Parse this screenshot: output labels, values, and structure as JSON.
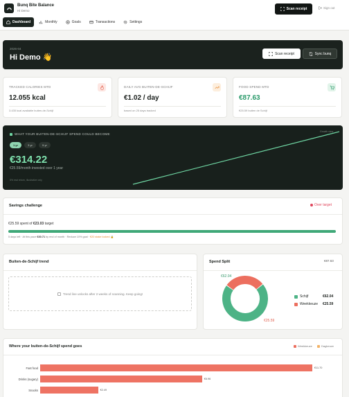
{
  "app": {
    "title": "Bunq Bite Balance",
    "subtitle": "Hi Demo"
  },
  "topbar": {
    "scan_label": "Scan receipt",
    "signout_label": "Sign out"
  },
  "nav": [
    "Dashboard",
    "Monthly",
    "Goals",
    "Transactions",
    "Settings"
  ],
  "hero": {
    "date": "2026-04",
    "greeting": "Hi Demo 👋",
    "scan_label": "Scan receipt",
    "sync_label": "Sync bunq"
  },
  "stats": [
    {
      "label": "Tracked calories MTD",
      "value": "12.055 kcal",
      "sub": "3.435 kcal available buiten-de-Schijf"
    },
    {
      "label": "Daily avg buiten-de-Schijf",
      "value": "€1.02 / day",
      "sub": "based on 25 days tracked"
    },
    {
      "label": "Food spend MTD",
      "value": "€87.63",
      "sub": "€25.59 buiten de Schijf"
    }
  ],
  "projection": {
    "title": "WHAT YOUR BUITEN-DE-SCHIJF SPEND COULD BECOME",
    "tag": "Growth view",
    "periods": [
      "1 yr",
      "3 yr",
      "5 yr"
    ],
    "active_period": "1 yr",
    "value": "€314.22",
    "sub": "€25.59/month invested over 1 year",
    "note": "5% real return, illustrative only"
  },
  "savings": {
    "title": "Savings challenge",
    "status": "Over target",
    "spent_prefix": "€25.59 spent of",
    "target": "€23.03",
    "spent_suffix": "target",
    "progress": 1.0,
    "note_a": "5 days left · At this pace",
    "pace": "€30.71",
    "note_b": "by end of month · Reduce 10% goal ·",
    "locked": "€20 stake locked 🔒"
  },
  "trend": {
    "title": "Buiten-de-Schijf trend",
    "empty": "Trend line unlocks after 2 weeks of scanning. Keep going!"
  },
  "split": {
    "title": "Spend Split",
    "total": "€87.63",
    "items": [
      {
        "name": "Schijf",
        "value": 62.04,
        "display": "€62.04",
        "color": "#4db386"
      },
      {
        "name": "Weekkeuze",
        "value": 25.59,
        "display": "€25.59",
        "color": "#ec6f5f"
      }
    ],
    "ring_label_a": "€62.04",
    "ring_label_b": "€25.59"
  },
  "categories": {
    "title": "Where your buiten-de-Schijf spend goes",
    "legend": [
      {
        "name": "Weekkeuze",
        "color": "#ec6f5f"
      },
      {
        "name": "Dagkeuze",
        "color": "#f2b266"
      }
    ],
    "items": [
      {
        "name": "Fast food",
        "value": 11.7,
        "display": "€11.70"
      },
      {
        "name": "Drinks (sugary)",
        "value": 6.96,
        "display": "€6.96"
      },
      {
        "name": "Snacks",
        "value": 2.49,
        "display": "€2.49"
      }
    ]
  }
}
